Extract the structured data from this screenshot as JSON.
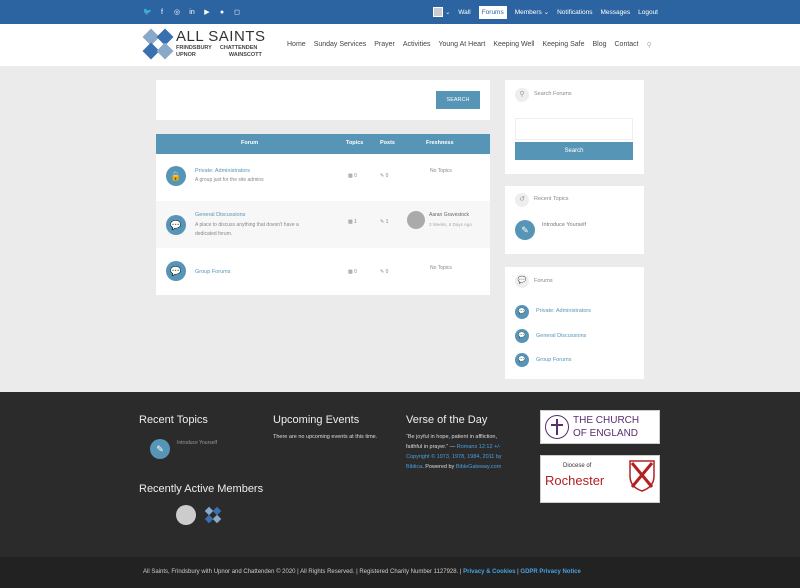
{
  "topbar": {
    "social": [
      "twitter-icon",
      "facebook-icon",
      "whatsapp-icon",
      "linkedin-icon",
      "youtube-icon",
      "flickr-icon",
      "instagram-icon"
    ],
    "links": {
      "wall": "Wall",
      "forums": "Forums",
      "members": "Members",
      "notifications": "Notifications",
      "messages": "Messages",
      "logout": "Logout"
    },
    "caret": "⌄"
  },
  "brand": {
    "title": "ALL SAINTS",
    "l1": "FRINDSBURY",
    "l2": "UPNOR",
    "l3": "CHATTENDEN",
    "l4": "WAINSCOTT"
  },
  "nav": [
    "Home",
    "Sunday Services",
    "Prayer",
    "Activities",
    "Young At Heart",
    "Keeping Well",
    "Keeping Safe",
    "Blog",
    "Contact"
  ],
  "search": {
    "button": "SEARCH"
  },
  "table": {
    "headers": {
      "forum": "Forum",
      "topics": "Topics",
      "posts": "Posts",
      "freshness": "Freshness"
    },
    "rows": [
      {
        "title": "Private: Administrators",
        "desc": "A group just for the site admins",
        "desc2": "",
        "topics": "0",
        "posts": "0",
        "fresh": "No Topics",
        "author": "",
        "time": ""
      },
      {
        "title": "General Discussions",
        "desc": "A place to discuss anything that doesn't have a",
        "desc2": "dedicated forum.",
        "topics": "1",
        "posts": "1",
        "fresh": "",
        "author": "Aaran Gravestock",
        "time": "3 Weeks, 6 Days Ago"
      },
      {
        "title": "Group Forums",
        "desc": "",
        "desc2": "",
        "topics": "0",
        "posts": "0",
        "fresh": "No Topics",
        "author": "",
        "time": ""
      }
    ]
  },
  "sidebar": {
    "search_title": "Search Forums",
    "search_button": "Search",
    "recent_title": "Recent Topics",
    "recent_item": "Introduce Yourself",
    "forums_title": "Forums",
    "forums": [
      "Private: Administrators",
      "General Discussions",
      "Group Forums"
    ]
  },
  "footer": {
    "recent_topics": "Recent Topics",
    "recent_item": "Introduce Yourself",
    "events": "Upcoming Events",
    "events_text": "There are no upcoming events at this time.",
    "verse": "Verse of the Day",
    "verse_text1": "“Be joyful in hope, patient in affliction,",
    "verse_text2": "faithful in prayer.” —",
    "verse_ref": "Romans 12:12",
    "verse_ref2": "+/-",
    "copyright1": "Copyright © 1973, 1978, 1984, 2011 by",
    "copyright2": "Biblica",
    "powered": ". Powered by",
    "bg": "BibleGateway.com",
    "members": "Recently Active Members",
    "coe1": "THE CHURCH",
    "coe2": "OF ENGLAND",
    "dio1": "Diocese of",
    "dio2": "Rochester"
  },
  "bottom": {
    "text": "All Saints, Frindsbury with Upnor and Chattenden © 2020 | All Rights Reserved. | Registered Charity Number 1127928. | ",
    "privacy": "Privacy & Cookies",
    "sep": " | ",
    "gdpr": "GDPR Privacy Notice"
  }
}
